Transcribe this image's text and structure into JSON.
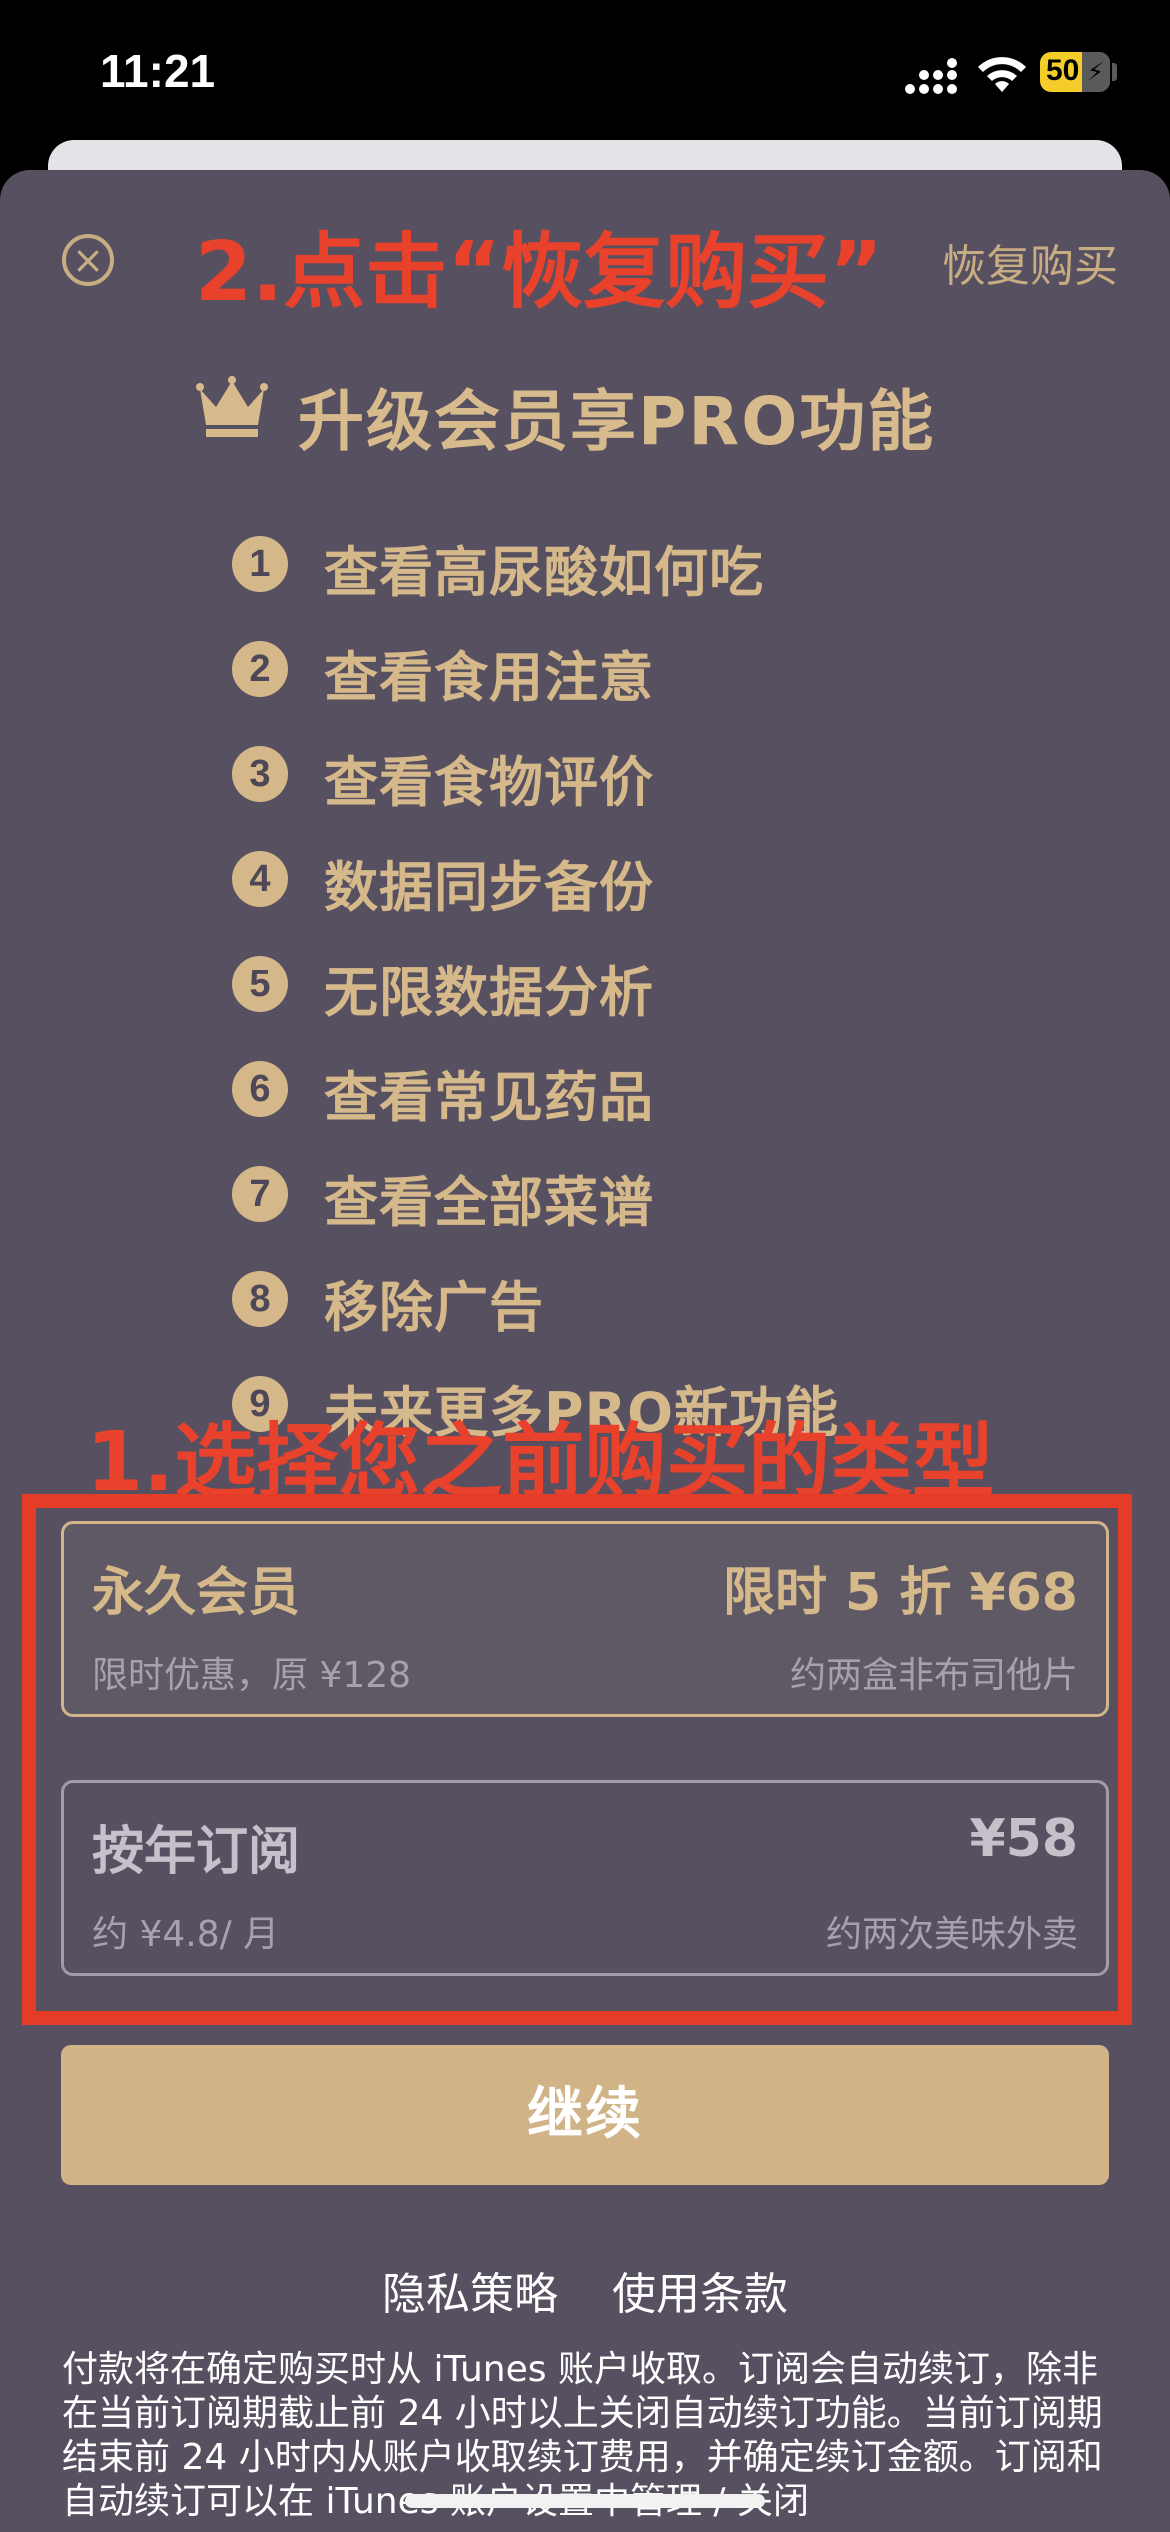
{
  "status_bar": {
    "time": "11:21",
    "battery_level": "50",
    "icons": [
      "cellular-signal-icon",
      "wifi-icon",
      "battery-charging-icon"
    ]
  },
  "header": {
    "close_icon": "close-circle-icon",
    "annotation_step2": "2.点击“恢复购买”",
    "restore_label": "恢复购买"
  },
  "hero": {
    "crown_icon": "crown-icon",
    "title": "升级会员享PRO功能"
  },
  "features": [
    {
      "num": "1",
      "label": "查看高尿酸如何吃"
    },
    {
      "num": "2",
      "label": "查看食用注意"
    },
    {
      "num": "3",
      "label": "查看食物评价"
    },
    {
      "num": "4",
      "label": "数据同步备份"
    },
    {
      "num": "5",
      "label": "无限数据分析"
    },
    {
      "num": "6",
      "label": "查看常见药品"
    },
    {
      "num": "7",
      "label": "查看全部菜谱"
    },
    {
      "num": "8",
      "label": "移除广告"
    },
    {
      "num": "9",
      "label": "未来更多PRO新功能"
    }
  ],
  "annotation_step1": "1.选择您之前购买的类型",
  "plans": [
    {
      "name": "永久会员",
      "price": "限时 5 折 ¥68",
      "sub": "限时优惠，原 ¥128",
      "note": "约两盒非布司他片"
    },
    {
      "name": "按年订阅",
      "price": "¥58",
      "sub": "约 ¥4.8/ 月",
      "note": "约两次美味外卖"
    }
  ],
  "continue_label": "继续",
  "links": {
    "privacy": "隐私策略",
    "terms": "使用条款"
  },
  "terms_text": "付款将在确定购买时从 iTunes 账户收取。订阅会自动续订，除非在当前订阅期截止前 24 小时以上关闭自动续订功能。当前订阅期结束前 24 小时内从账户收取续订费用，并确定续订金额。订阅和自动续订可以在 iTunes 账户设置中管理 / 关闭",
  "colors": {
    "sheet_bg": "#575060",
    "gold": "#d5b98b",
    "annotation_red": "#e8412c",
    "continue_bg": "#d0b386"
  }
}
